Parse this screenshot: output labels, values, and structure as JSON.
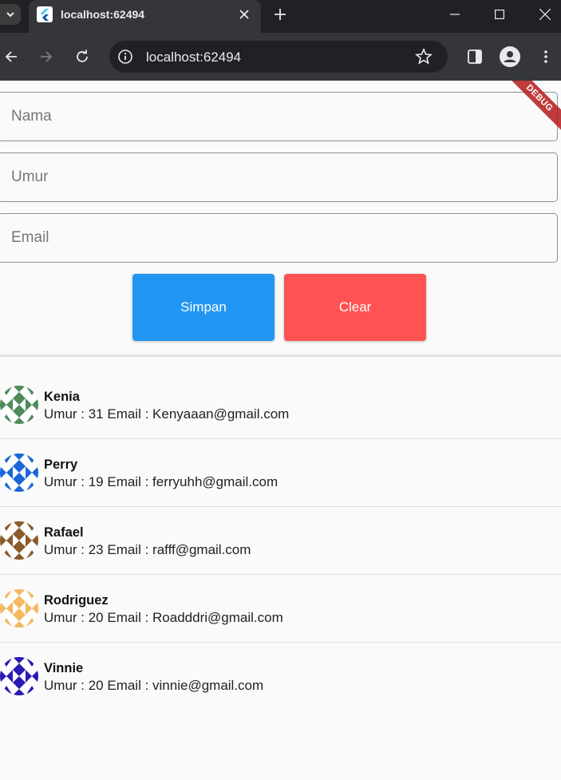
{
  "browser": {
    "tab_title": "localhost:62494",
    "url": "localhost:62494"
  },
  "form": {
    "nama_placeholder": "Nama",
    "umur_placeholder": "Umur",
    "email_placeholder": "Email",
    "simpan_label": "Simpan",
    "clear_label": "Clear",
    "colors": {
      "simpan": "#2196f3",
      "clear": "#ff5252"
    }
  },
  "debug_banner": "DEBUG",
  "people": [
    {
      "name": "Kenia",
      "detail": "Umur : 31 Email : Kenyaaan@gmail.com",
      "avatar_color": "#4e8a5a"
    },
    {
      "name": "Perry",
      "detail": "Umur : 19 Email : ferryuhh@gmail.com",
      "avatar_color": "#1a66d9"
    },
    {
      "name": "Rafael",
      "detail": "Umur : 23 Email : rafff@gmail.com",
      "avatar_color": "#8a5a2b"
    },
    {
      "name": "Rodriguez",
      "detail": "Umur : 20 Email : Roadddri@gmail.com",
      "avatar_color": "#f4b860"
    },
    {
      "name": "Vinnie",
      "detail": "Umur : 20 Email : vinnie@gmail.com",
      "avatar_color": "#2a1ab4"
    }
  ]
}
